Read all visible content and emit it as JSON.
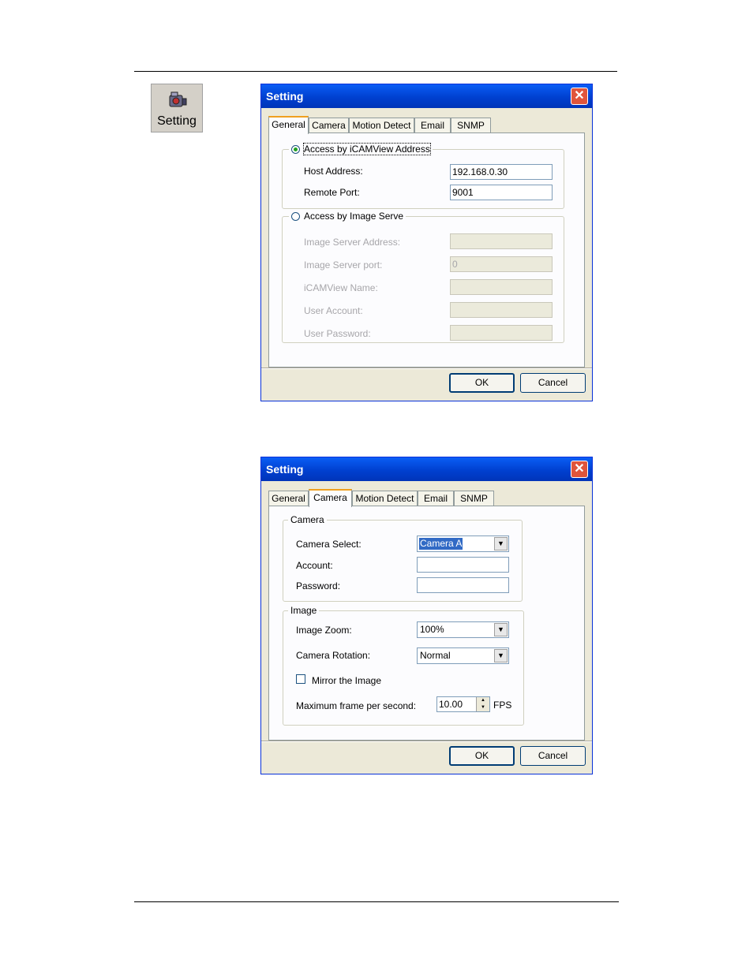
{
  "toolbar_button": {
    "label": "Setting",
    "icon": "settings-camera-icon"
  },
  "dialog1": {
    "title": "Setting",
    "tabs": [
      "General",
      "Camera",
      "Motion Detect",
      "Email",
      "SNMP"
    ],
    "active_tab": "General",
    "group_icamview": {
      "label": "Access by iCAMView Address",
      "selected": true,
      "host_label": "Host Address:",
      "host_value": "192.168.0.30",
      "port_label": "Remote Port:",
      "port_value": "9001"
    },
    "group_image_server": {
      "label": "Access by Image Serve",
      "selected": false,
      "fields": [
        {
          "label": "Image Server Address:",
          "value": ""
        },
        {
          "label": "Image Server port:",
          "value": "0"
        },
        {
          "label": "iCAMView Name:",
          "value": ""
        },
        {
          "label": "User Account:",
          "value": ""
        },
        {
          "label": "User Password:",
          "value": ""
        }
      ]
    },
    "ok_label": "OK",
    "cancel_label": "Cancel"
  },
  "dialog2": {
    "title": "Setting",
    "tabs": [
      "General",
      "Camera",
      "Motion Detect",
      "Email",
      "SNMP"
    ],
    "active_tab": "Camera",
    "camera_group": {
      "label": "Camera",
      "select_label": "Camera Select:",
      "select_value": "Camera A",
      "account_label": "Account:",
      "account_value": "",
      "password_label": "Password:",
      "password_value": ""
    },
    "image_group": {
      "label": "Image",
      "zoom_label": "Image Zoom:",
      "zoom_value": "100%",
      "rotation_label": "Camera Rotation:",
      "rotation_value": "Normal",
      "mirror_label": "Mirror the Image",
      "mirror_checked": false,
      "fps_label": "Maximum frame per second:",
      "fps_value": "10.00",
      "fps_unit": "FPS"
    },
    "ok_label": "OK",
    "cancel_label": "Cancel"
  }
}
